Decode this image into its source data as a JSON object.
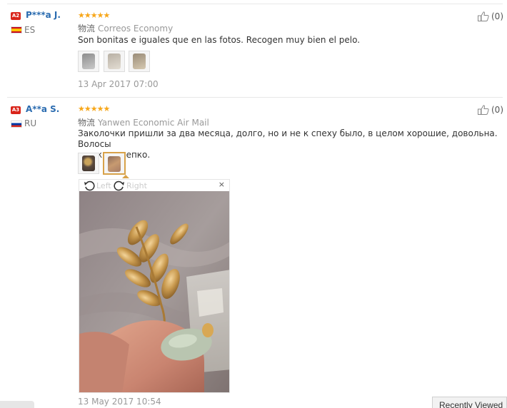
{
  "reviews": [
    {
      "badge": "A2",
      "user": "P***a J.",
      "country": "ES",
      "stars": "★★★★★",
      "shipping_label": "物流",
      "shipping": "Correos Economy",
      "text": "Son bonitas e iguales que en las fotos. Recogen muy bien el pelo.",
      "date": "13 Apr 2017 07:00",
      "likes": "(0)"
    },
    {
      "badge": "A3",
      "user": "A**a S.",
      "country": "RU",
      "stars": "★★★★★",
      "shipping_label": "物流",
      "shipping": "Yanwen Economic Air Mail",
      "text_line1": "Заколочки пришли за два месяца, долго, но и не к спеху было, в целом хорошие, довольна. Волосы",
      "text_line2": "держит крепко.",
      "date": "13 May 2017 10:54",
      "likes": "(0)"
    }
  ],
  "viewer": {
    "rotate_left": "Left",
    "rotate_right": "Right",
    "close": "×"
  },
  "recently_viewed": "Recently Viewed",
  "icons": {
    "like": "thumbs-up-icon",
    "rotate_left": "rotate-left-icon",
    "rotate_right": "rotate-right-icon",
    "close": "close-icon"
  },
  "colors": {
    "star": "#f7a71a",
    "username": "#2b6cb0",
    "badge": "#d9251b",
    "active_thumb": "#d8a24a"
  }
}
